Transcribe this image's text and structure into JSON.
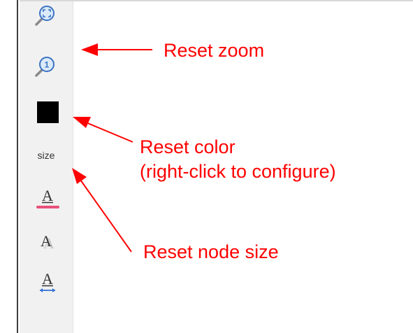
{
  "toolbar": {
    "buttons": [
      {
        "icon": "zoom-fit-icon"
      },
      {
        "icon": "zoom-reset-icon"
      },
      {
        "icon": "color-swatch-icon",
        "color": "#000000"
      },
      {
        "label": "size"
      },
      {
        "icon": "text-color-icon",
        "underline_color": "#e8517a"
      },
      {
        "icon": "text-shadow-icon"
      },
      {
        "icon": "text-width-icon",
        "arrow_color": "#2f6fd6"
      }
    ]
  },
  "annotations": {
    "reset_zoom": "Reset zoom",
    "reset_color_line1": "Reset color",
    "reset_color_line2": "(right-click to configure)",
    "reset_node_size": "Reset node size",
    "color": "#ff0000"
  }
}
